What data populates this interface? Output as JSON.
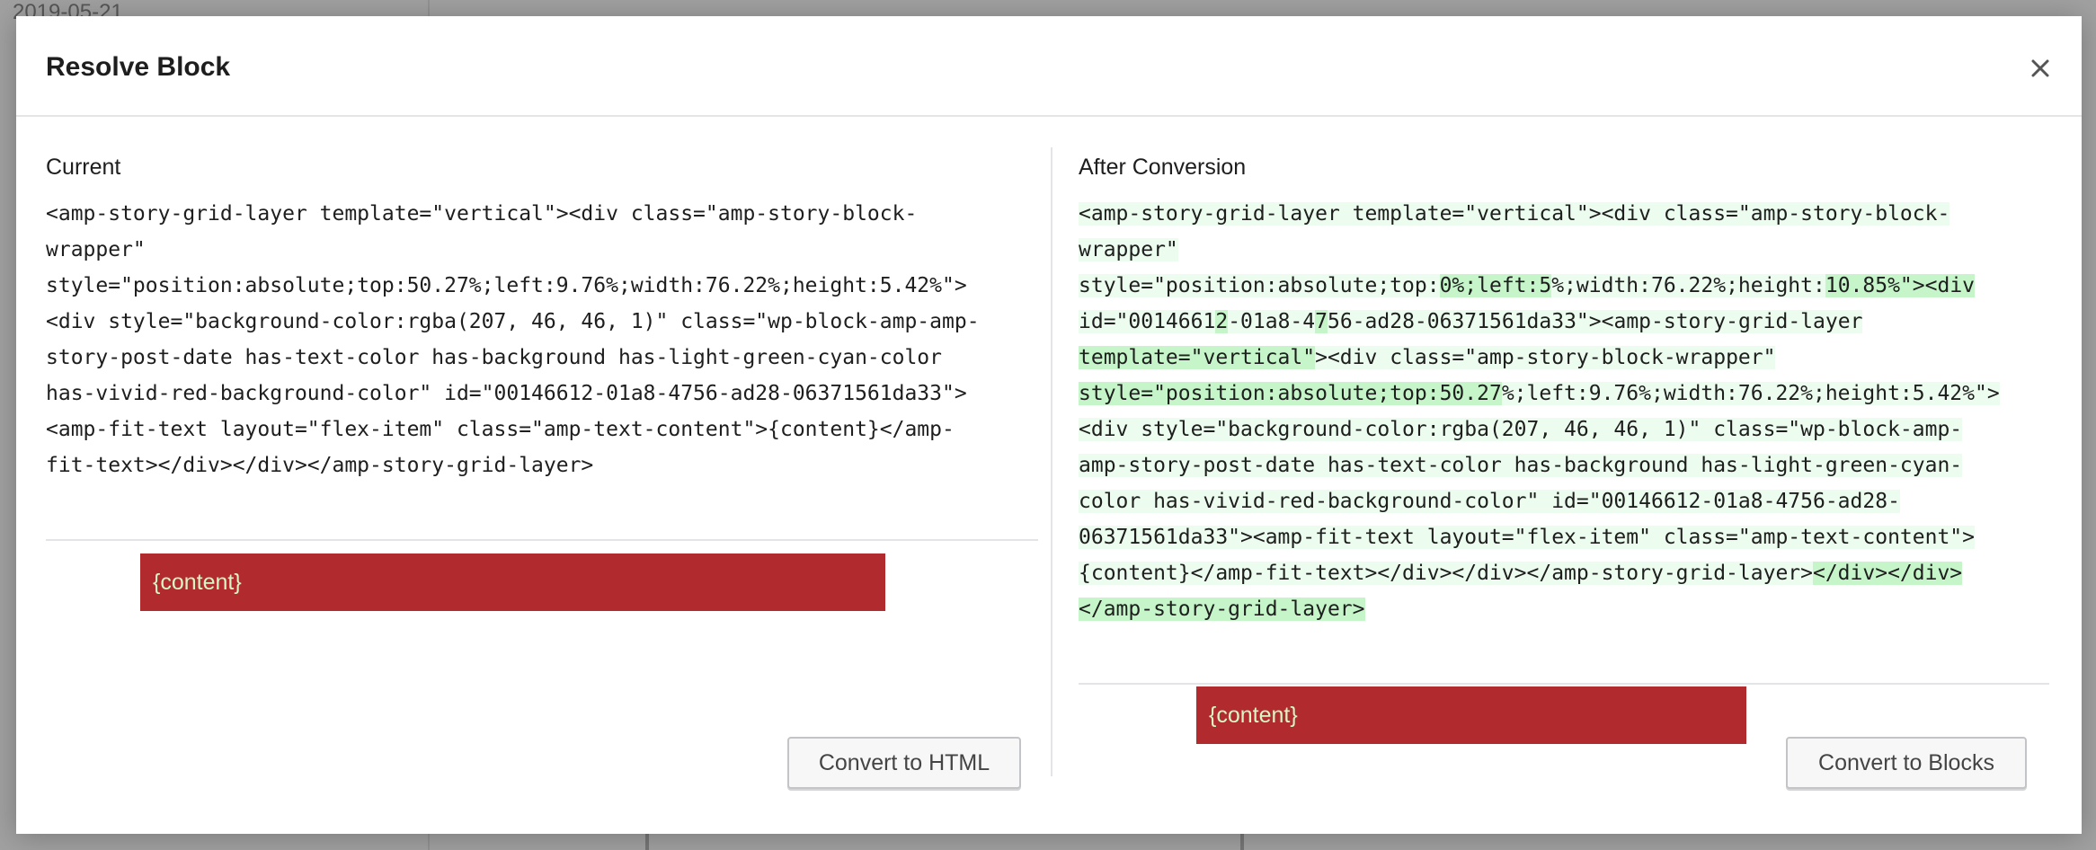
{
  "background": {
    "date_text": "2019-05-21"
  },
  "modal": {
    "title": "Resolve Block",
    "close_icon": "close-icon"
  },
  "current": {
    "title": "Current",
    "code_lines": [
      "<amp-story-grid-layer template=\"vertical\"><div class=\"amp-story-block-",
      "wrapper\"",
      "style=\"position:absolute;top:50.27%;left:9.76%;width:76.22%;height:5.42%\">",
      "<div style=\"background-color:rgba(207, 46, 46, 1)\" class=\"wp-block-amp-amp-",
      "story-post-date has-text-color has-background has-light-green-cyan-color",
      "has-vivid-red-background-color\" id=\"00146612-01a8-4756-ad28-06371561da33\">",
      "<amp-fit-text layout=\"flex-item\" class=\"amp-text-content\">{content}</amp-",
      "fit-text></div></div></amp-story-grid-layer>"
    ],
    "preview_text": "{content}",
    "button_label": "Convert to HTML"
  },
  "after": {
    "title": "After Conversion",
    "code_lines": [
      [
        {
          "t": "<amp-story-grid-layer template=\"vertical\"><div class=\"amp-story-block-",
          "h": "light"
        }
      ],
      [
        {
          "t": "wrapper\"",
          "h": "light"
        }
      ],
      [
        {
          "t": "style=\"position:absolute;top:",
          "h": "light"
        },
        {
          "t": "0%;left:5",
          "h": "strong"
        },
        {
          "t": "%;width:76.22%;height:",
          "h": "light"
        },
        {
          "t": "10.85%\"><div",
          "h": "strong"
        }
      ],
      [
        {
          "t": "id=\"0014661",
          "h": "light"
        },
        {
          "t": "2",
          "h": "strong"
        },
        {
          "t": "-01a8-4",
          "h": "light"
        },
        {
          "t": "7",
          "h": "strong"
        },
        {
          "t": "56-ad28-06371561da33\"><amp-story-grid-layer",
          "h": "light"
        }
      ],
      [
        {
          "t": "template=\"vertical\"",
          "h": "strong"
        },
        {
          "t": "><div class=\"amp-story-block-wrapper\"",
          "h": "light"
        }
      ],
      [
        {
          "t": "style=\"position:absolute;top:50.27",
          "h": "strong"
        },
        {
          "t": "%;left:9.76%;width:76.22%;height:5.42%\">",
          "h": "light"
        }
      ],
      [
        {
          "t": "<div style=\"background-color:rgba(207, 46, 46, 1)\" class=\"wp-block-amp-",
          "h": "light"
        }
      ],
      [
        {
          "t": "amp-story-post-date has-text-color has-background has-light-green-cyan-",
          "h": "light"
        }
      ],
      [
        {
          "t": "color has-vivid-red-background-color\" id=\"00146612-01a8-4756-ad28-",
          "h": "light"
        }
      ],
      [
        {
          "t": "06371561da33\"><amp-fit-text layout=\"flex-item\" class=\"amp-text-content\">",
          "h": "light"
        }
      ],
      [
        {
          "t": "{content}</amp-fit-text></div></div></amp-story-grid-layer>",
          "h": "light"
        },
        {
          "t": "</div></div>",
          "h": "strong"
        }
      ],
      [
        {
          "t": "</amp-story-grid-layer>",
          "h": "strong"
        }
      ]
    ],
    "preview_text": "{content}",
    "button_label": "Convert to Blocks"
  },
  "colors": {
    "preview_bg": "#b12b2e",
    "preview_text": "#d8f5c5",
    "diff_light": "#ecfcee",
    "diff_strong": "#c5f5c9"
  }
}
